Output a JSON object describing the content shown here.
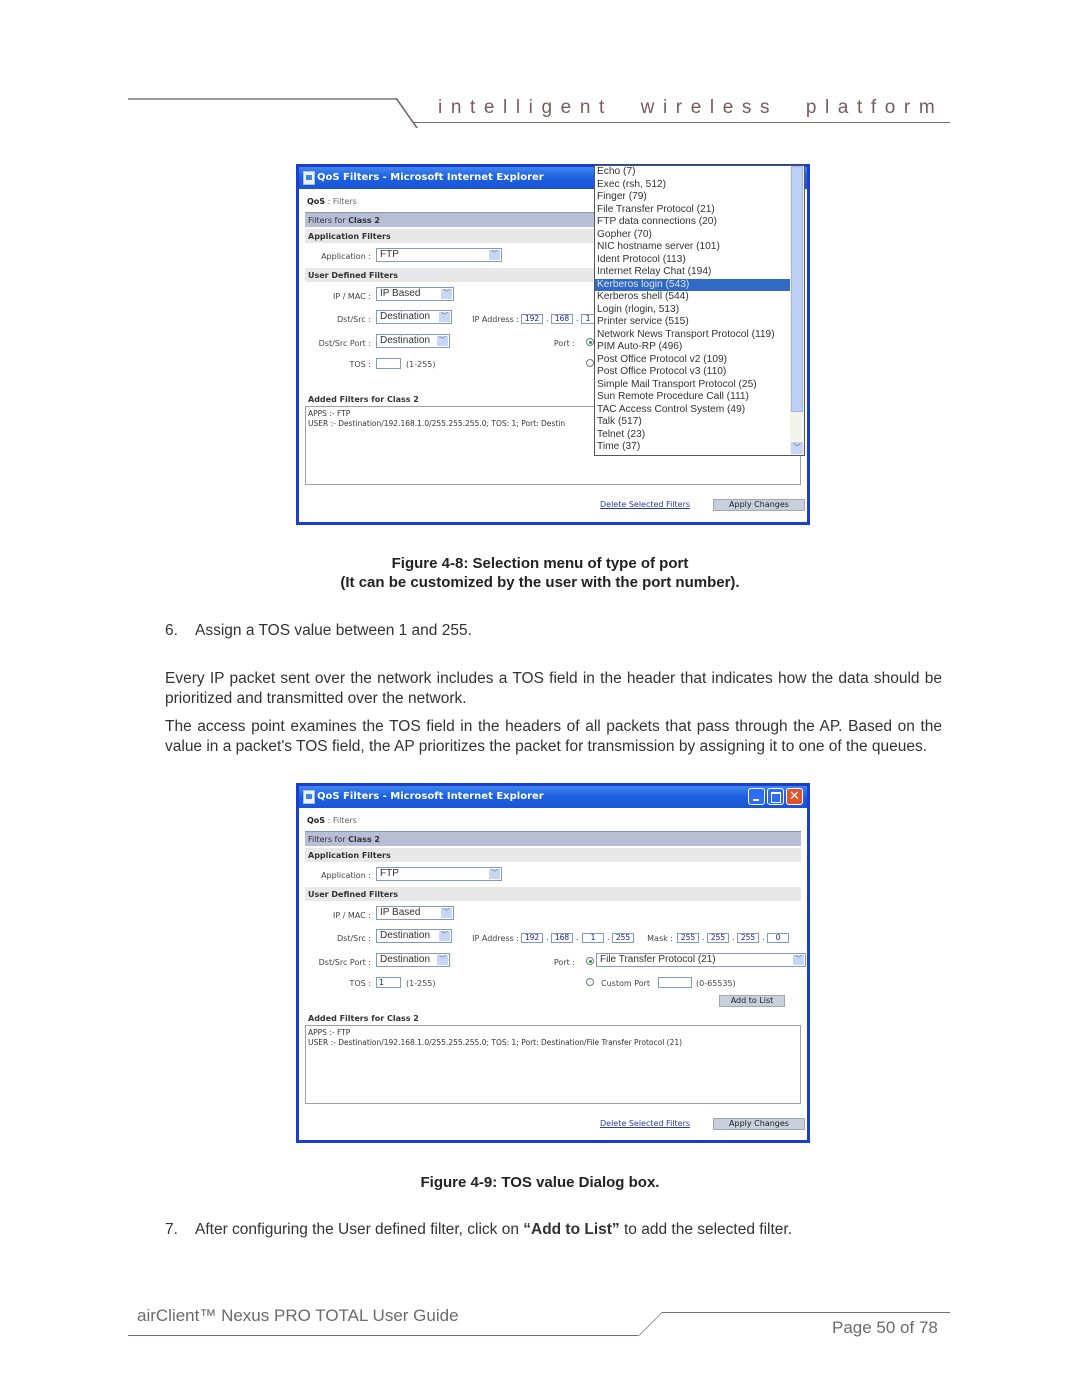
{
  "header": {
    "tagline": "intelligent  wireless  platform"
  },
  "footer": {
    "guide_title": "airClient™ Nexus PRO TOTAL User Guide",
    "page": "Page 50 of 78"
  },
  "figure1": {
    "window_title": "QoS Filters - Microsoft Internet Explorer",
    "breadcrumb_bold": "QoS",
    "breadcrumb_rest": " : Filters",
    "filters_for_label": "Filters for ",
    "filters_for_class": "Class 2",
    "app_filters_heading": "Application Filters",
    "application_label": "Application :",
    "application_value": "FTP",
    "user_filters_heading": "User Defined Filters",
    "ipmac_label": "IP / MAC :",
    "ipmac_value": "IP Based",
    "dstsrc_label": "Dst/Src :",
    "dstsrc_value": "Destination",
    "ip_address_label": "IP Address :",
    "ip": [
      "192",
      "168",
      "1"
    ],
    "dstsrc_port_label": "Dst/Src Port :",
    "dstsrc_port_value": "Destination",
    "port_label": "Port :",
    "tos_label": "TOS :",
    "tos_value": "",
    "tos_range": "(1-255)",
    "added_heading": "Added Filters for Class 2",
    "added_lines": [
      "APPS :- FTP",
      "USER :- Destination/192.168.1.0/255.255.255.0; TOS: 1; Port: Destin"
    ],
    "delete_link": "Delete Selected Filters",
    "apply_button": "Apply Changes",
    "port_options": [
      "Echo (7)",
      "Exec (rsh, 512)",
      "Finger (79)",
      "File Transfer Protocol (21)",
      "FTP data connections (20)",
      "Gopher (70)",
      "NIC hostname server (101)",
      "Ident Protocol (113)",
      "Internet Relay Chat (194)",
      "Kerberos login (543)",
      "Kerberos shell (544)",
      "Login (rlogin, 513)",
      "Printer service (515)",
      "Network News Transport Protocol (119)",
      "PIM Auto-RP (496)",
      "Post Office Protocol v2 (109)",
      "Post Office Protocol v3 (110)",
      "Simple Mail Transport Protocol (25)",
      "Sun Remote Procedure Call (111)",
      "TAC Access Control System (49)",
      "Talk (517)",
      "Telnet (23)",
      "Time (37)"
    ],
    "highlighted_option": "Kerberos login (543)"
  },
  "caption1": {
    "line1": "Figure 4-8: Selection menu of type of port",
    "line2": "(It can be customized by the user with the port number)."
  },
  "step6": {
    "num": "6.",
    "text": "Assign a TOS value between 1 and 255."
  },
  "para1": "Every IP packet sent over the network includes a TOS field in the header that indicates how the data should be prioritized and transmitted over the network.",
  "para2": "The access point examines the TOS field in the headers of all packets that pass through the AP. Based on the value in a packet's TOS field, the AP prioritizes the packet for transmission by assigning it to one of the queues.",
  "figure2": {
    "window_title": "QoS Filters - Microsoft Internet Explorer",
    "close_glyph": "✕",
    "breadcrumb_bold": "QoS",
    "breadcrumb_rest": " : Filters",
    "filters_for_label": "Filters for ",
    "filters_for_class": "Class 2",
    "app_filters_heading": "Application Filters",
    "application_label": "Application :",
    "application_value": "FTP",
    "user_filters_heading": "User Defined Filters",
    "ipmac_label": "IP / MAC :",
    "ipmac_value": "IP Based",
    "dstsrc_label": "Dst/Src :",
    "dstsrc_value": "Destination",
    "ip_address_label": "IP Address :",
    "ip": [
      "192",
      "168",
      "1",
      "255"
    ],
    "mask_label": "Mask :",
    "mask": [
      "255",
      "255",
      "255",
      "0"
    ],
    "dstsrc_port_label": "Dst/Src Port :",
    "dstsrc_port_value": "Destination",
    "port_label": "Port :",
    "port_value": "File Transfer Protocol (21)",
    "custom_port_label": "Custom Port",
    "custom_port_value": "",
    "custom_port_range": "(0-65535)",
    "tos_label": "TOS :",
    "tos_value": "1",
    "tos_range": "(1-255)",
    "add_to_list_button": "Add to List",
    "added_heading": "Added Filters for Class 2",
    "added_lines": [
      "APPS :- FTP",
      "USER :- Destination/192.168.1.0/255.255.255.0; TOS: 1; Port: Destination/File Transfer Protocol (21)"
    ],
    "delete_link": "Delete Selected Filters",
    "apply_button": "Apply Changes"
  },
  "caption2": {
    "line1": "Figure 4-9: TOS value Dialog box."
  },
  "step7": {
    "num": "7.",
    "text_before": "After configuring the User defined filter, click on ",
    "text_bold": "“Add to List”",
    "text_after": " to add the selected filter."
  }
}
